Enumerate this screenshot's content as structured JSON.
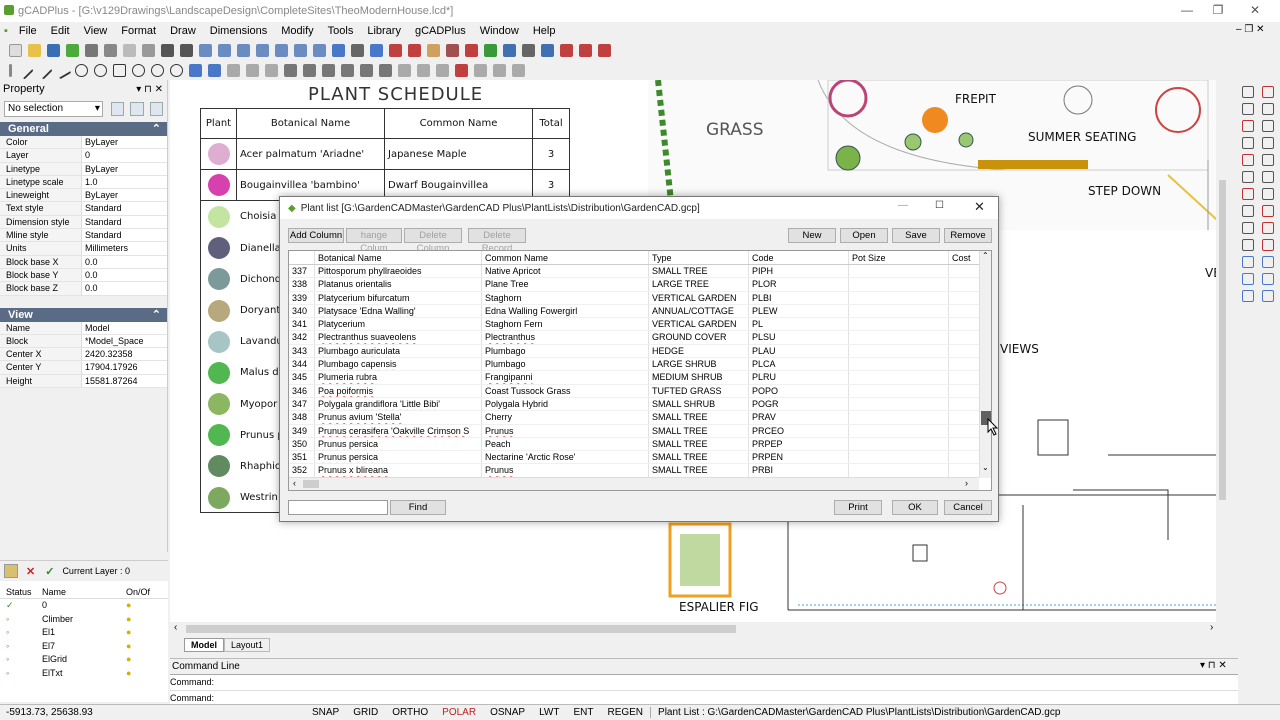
{
  "window": {
    "title": "gCADPlus - [G:\\v129Drawings\\LandscapeDesign\\CompleteSites\\TheoModernHouse.lcd*]"
  },
  "menu": [
    "File",
    "Edit",
    "View",
    "Format",
    "Draw",
    "Dimensions",
    "Modify",
    "Tools",
    "Library",
    "gCADPlus",
    "Window",
    "Help"
  ],
  "property": {
    "title": "Property",
    "selection": "No selection",
    "general_label": "General",
    "general": [
      [
        "Color",
        "ByLayer"
      ],
      [
        "Layer",
        "0"
      ],
      [
        "Linetype",
        "ByLayer"
      ],
      [
        "Linetype scale",
        "1.0"
      ],
      [
        "Lineweight",
        "ByLayer"
      ],
      [
        "Text style",
        "Standard"
      ],
      [
        "Dimension style",
        "Standard"
      ],
      [
        "Mline style",
        "Standard"
      ],
      [
        "Units",
        "Millimeters"
      ],
      [
        "Block base X",
        "0.0"
      ],
      [
        "Block base Y",
        "0.0"
      ],
      [
        "Block base Z",
        "0.0"
      ]
    ],
    "view_label": "View",
    "view": [
      [
        "Name",
        "Model"
      ],
      [
        "Block",
        "*Model_Space"
      ],
      [
        "Center X",
        "2420.32358"
      ],
      [
        "Center Y",
        "17904.17926"
      ],
      [
        "Height",
        "15581.87264"
      ]
    ]
  },
  "layers": {
    "current": "Current Layer : 0",
    "headers": [
      "Status",
      "Name",
      "On/Of"
    ],
    "rows": [
      "0",
      "Climber",
      "El1",
      "El7",
      "ElGrid",
      "ElTxt"
    ]
  },
  "schedule": {
    "title": "PLANT SCHEDULE",
    "headers": [
      "Plant",
      "Botanical Name",
      "Common Name",
      "Total"
    ],
    "rows": [
      [
        "Acer palmatum 'Ariadne'",
        "Japanese Maple",
        "3"
      ],
      [
        "Bougainvillea 'bambino'",
        "Dwarf Bougainvillea",
        "3"
      ],
      [
        "Choisia t",
        "",
        " "
      ],
      [
        "Dianella r",
        "",
        ""
      ],
      [
        "Dichondr",
        "",
        ""
      ],
      [
        "Doryanth",
        "",
        ""
      ],
      [
        "Lavandul",
        "",
        ""
      ],
      [
        "Malus do",
        "",
        ""
      ],
      [
        "Myopor",
        "",
        ""
      ],
      [
        "Prunus p",
        "",
        ""
      ],
      [
        "Rhaphiol Border",
        "",
        ""
      ],
      [
        "Westrin",
        "",
        ""
      ]
    ]
  },
  "drawing_labels": {
    "grass": "GRASS",
    "frepit": "FREPIT",
    "summer": "SUMMER SEATING",
    "step": "STEP DOWN",
    "views": "VIEWS",
    "espalier": "ESPALIER FIG",
    "ve": "VE"
  },
  "tabs": [
    "Model",
    "Layout1"
  ],
  "dialog": {
    "title": "Plant list [G:\\GardenCADMaster\\GardenCAD Plus\\PlantLists\\Distribution\\GardenCAD.gcp]",
    "buttons": {
      "add": "Add Column",
      "change": "hange Colum",
      "delete": "Delete Column",
      "deleter": "Delete Record",
      "new": "New",
      "open": "Open",
      "save": "Save",
      "remove": "Remove",
      "find": "Find",
      "print": "Print",
      "ok": "OK",
      "cancel": "Cancel"
    },
    "columns": [
      "",
      "Botanical Name",
      "Common Name",
      "Type",
      "Code",
      "Pot Size",
      "Cost"
    ],
    "rows": [
      [
        "337",
        "Pittosporum phyllraeoides",
        "Native Apricot",
        "SMALL TREE",
        "PIPH"
      ],
      [
        "338",
        "Platanus orientalis",
        "Plane Tree",
        "LARGE TREE",
        "PLOR"
      ],
      [
        "339",
        "Platycerium bifurcatum",
        "Staghorn",
        "VERTICAL GARDEN",
        "PLBI"
      ],
      [
        "340",
        "Platysace 'Edna Walling'",
        "Edna Walling Fowergirl",
        "ANNUAL/COTTAGE",
        "PLEW"
      ],
      [
        "341",
        "Platycerium",
        "Staghorn Fern",
        "VERTICAL GARDEN",
        "PL"
      ],
      [
        "342",
        "Plectranthus suaveolens",
        "Plectranthus",
        "GROUND COVER",
        "PLSU"
      ],
      [
        "343",
        "Plumbago auriculata",
        "Plumbago",
        "HEDGE",
        "PLAU"
      ],
      [
        "344",
        "Plumbago capensis",
        "Plumbago",
        "LARGE SHRUB",
        "PLCA"
      ],
      [
        "345",
        "Plumeria rubra",
        "Frangipanni",
        "MEDIUM SHRUB",
        "PLRU"
      ],
      [
        "346",
        "Poa poiformis",
        "Coast Tussock Grass",
        "TUFTED GRASS",
        "POPO"
      ],
      [
        "347",
        "Polygala grandiflora 'Little Bibi'",
        "Polygala Hybrid",
        "SMALL SHRUB",
        "POGR"
      ],
      [
        "348",
        "Prunus avium 'Stella'",
        "Cherry",
        "SMALL TREE",
        "PRAV"
      ],
      [
        "349",
        "Prunus cerasifera 'Oakville Crimson S",
        "Prunus",
        "SMALL TREE",
        "PRCEO"
      ],
      [
        "350",
        "Prunus persica",
        "Peach",
        "SMALL TREE",
        "PRPEP"
      ],
      [
        "351",
        "Prunus persica",
        "Nectarine 'Arctic Rose'",
        "SMALL TREE",
        "PRPEN"
      ],
      [
        "352",
        "Prunus x blireana",
        "Prunus",
        "SMALL TREE",
        "PRBI"
      ]
    ]
  },
  "command": {
    "title": "Command Line",
    "line1": "Command:",
    "line2": "Command:"
  },
  "status": {
    "coords": "-5913.73, 25638.93",
    "items": [
      "SNAP",
      "GRID",
      "ORTHO",
      "POLAR",
      "OSNAP",
      "LWT",
      "ENT",
      "REGEN"
    ],
    "message": "Plant List : G:\\GardenCADMaster\\GardenCAD Plus\\PlantLists\\Distribution\\GardenCAD.gcp"
  }
}
